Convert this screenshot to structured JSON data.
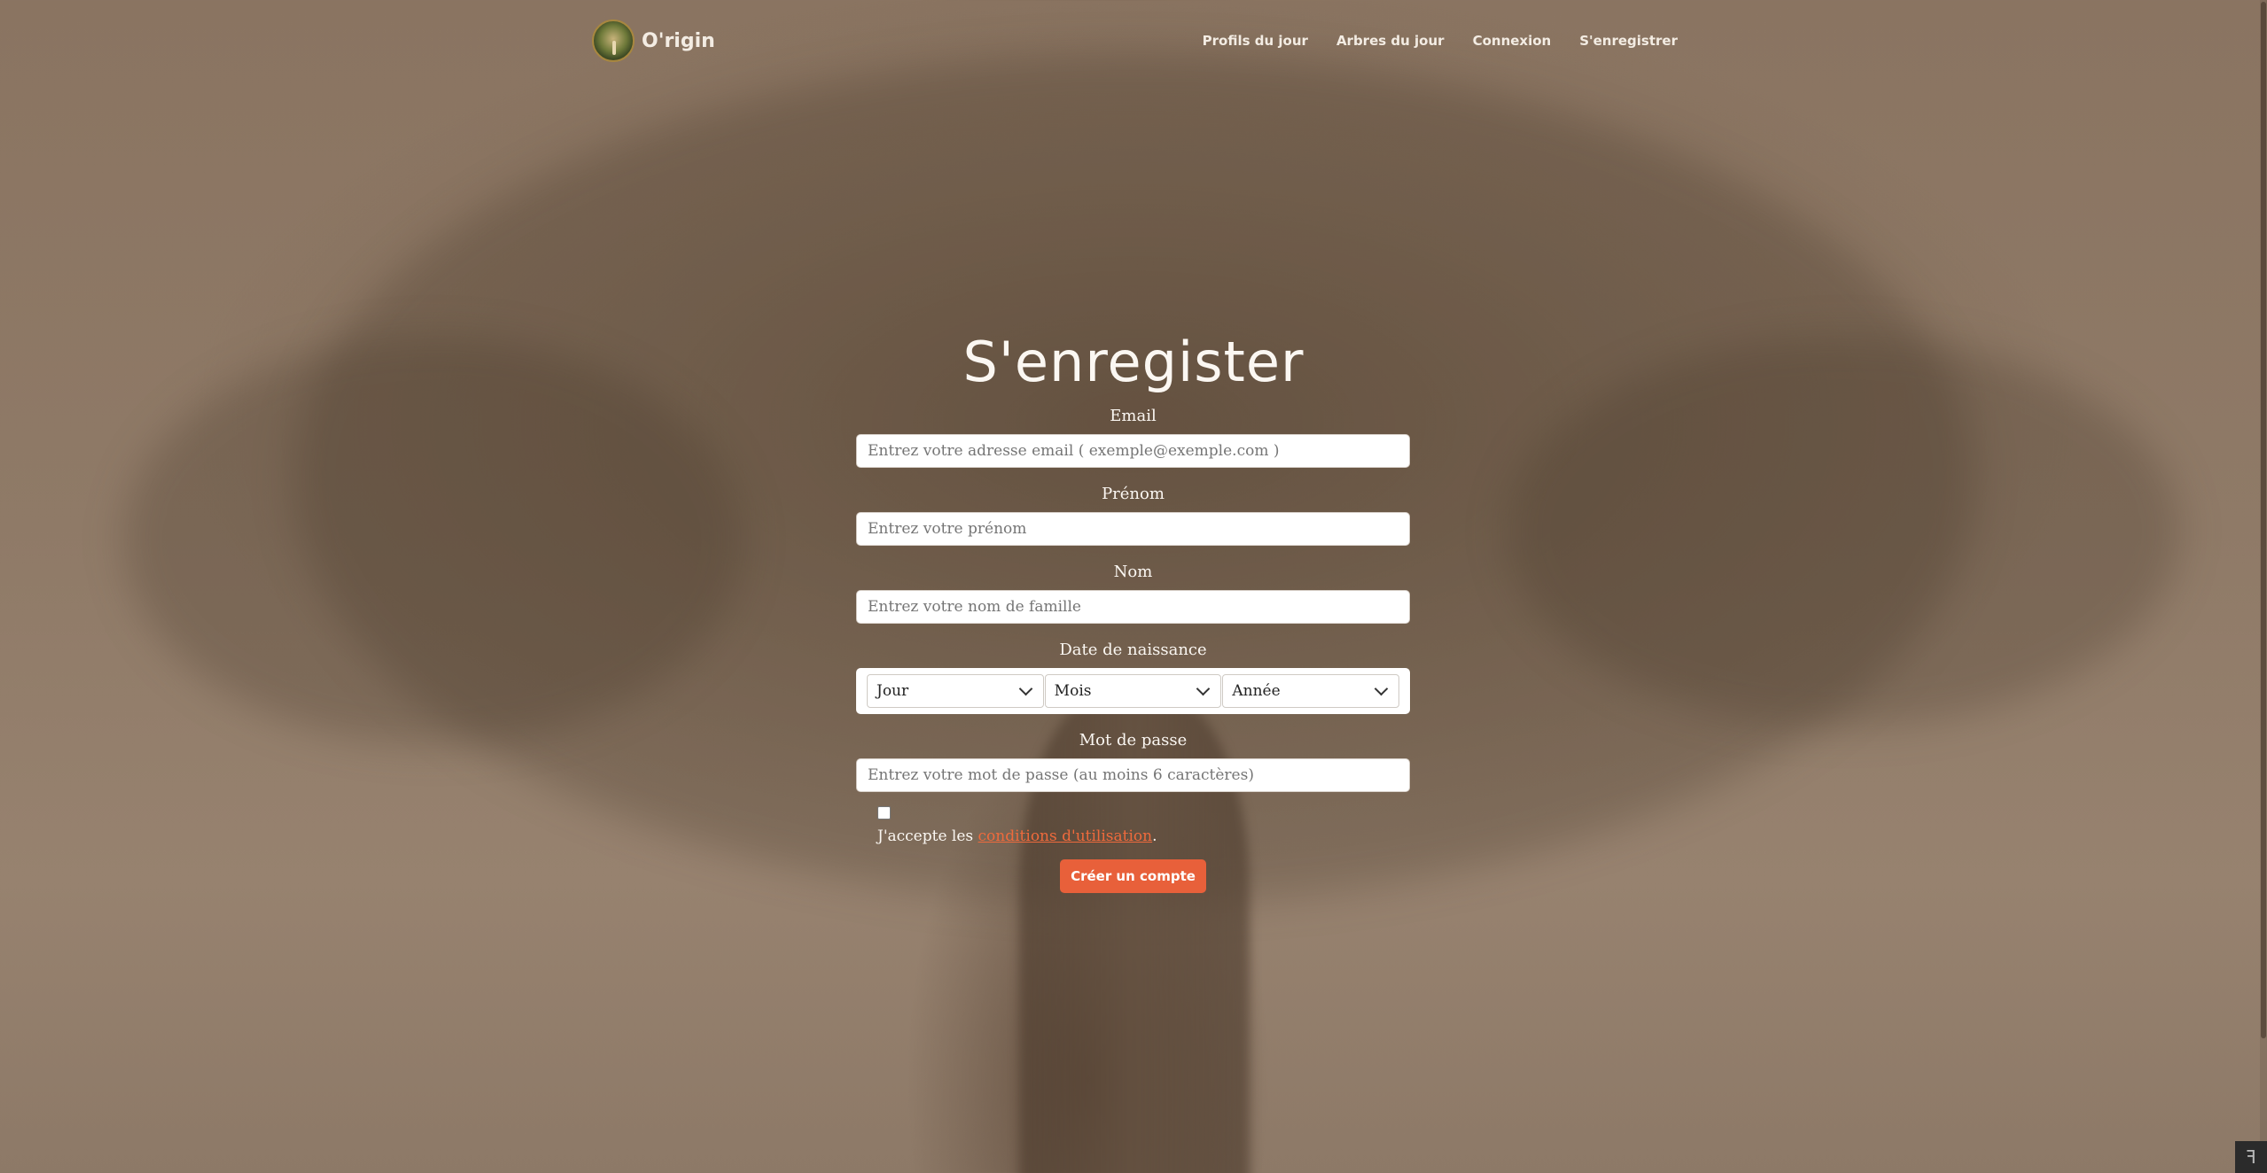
{
  "navbar": {
    "brand": "O'rigin",
    "links": [
      "Profils du jour",
      "Arbres du jour",
      "Connexion",
      "S'enregistrer"
    ]
  },
  "page": {
    "title": "S'enregister"
  },
  "form": {
    "email": {
      "label": "Email",
      "placeholder": "Entrez votre adresse email ( exemple@exemple.com )"
    },
    "firstname": {
      "label": "Prénom",
      "placeholder": "Entrez votre prénom"
    },
    "lastname": {
      "label": "Nom",
      "placeholder": "Entrez votre nom de famille"
    },
    "birthdate": {
      "label": "Date de naissance",
      "day": "Jour",
      "month": "Mois",
      "year": "Année"
    },
    "password": {
      "label": "Mot de passe",
      "placeholder": "Entrez votre mot de passe (au moins 6 caractères)"
    },
    "terms": {
      "prefix": "J'accepte les ",
      "link": "conditions d'utilisation",
      "suffix": ".",
      "checked": false
    },
    "submit_label": "Créer un compte"
  },
  "colors": {
    "accent": "#e8603a",
    "link": "#ef6a3c",
    "text": "#fbf7f2"
  }
}
